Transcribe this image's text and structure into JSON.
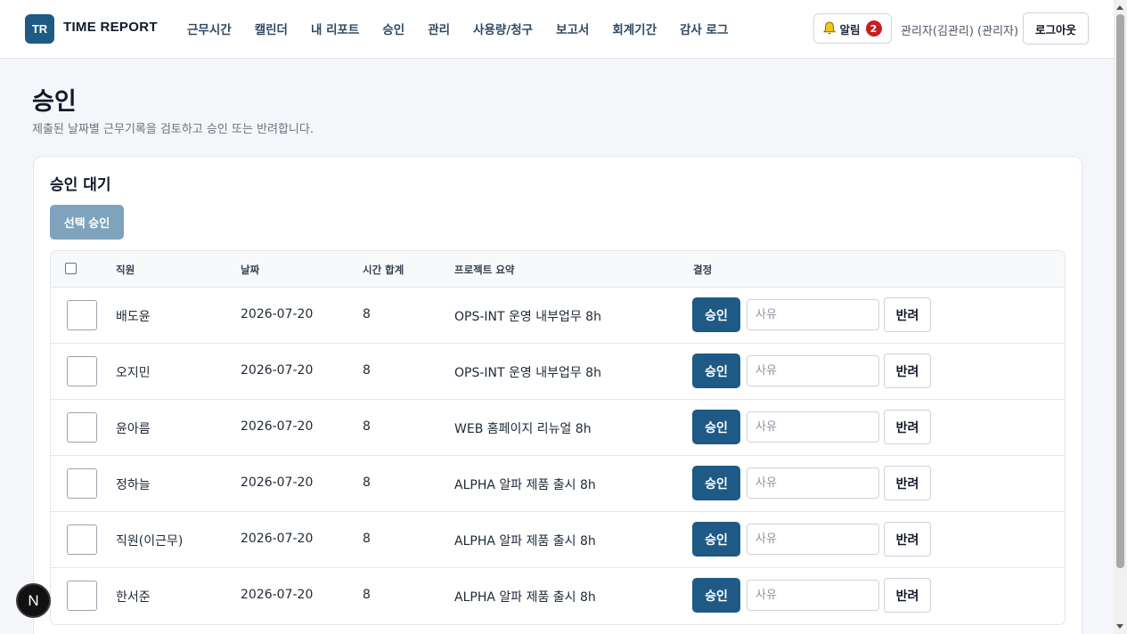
{
  "header": {
    "logo_text": "TR",
    "brand": "TIME REPORT",
    "nav": [
      "근무시간",
      "캘린더",
      "내 리포트",
      "승인",
      "관리",
      "사용량/청구",
      "보고서",
      "회계기간",
      "감사 로그"
    ],
    "alarm_label": "알림",
    "alarm_count": "2",
    "user_label": "관리자(김관리) (관리자)",
    "logout_label": "로그아웃"
  },
  "page": {
    "title": "승인",
    "subtitle": "제출된 날짜별 근무기록을 검토하고 승인 또는 반려합니다."
  },
  "card": {
    "title": "승인 대기",
    "bulk_approve_label": "선택 승인"
  },
  "table": {
    "headers": {
      "employee": "직원",
      "date": "날짜",
      "hours": "시간 합계",
      "project": "프로젝트 요약",
      "decision": "결정"
    },
    "rows": [
      {
        "employee": "배도윤",
        "date": "2026-07-20",
        "hours": "8",
        "project": "OPS-INT 운영 내부업무 8h",
        "approve": "승인",
        "reason_placeholder": "사유",
        "reject": "반려"
      },
      {
        "employee": "오지민",
        "date": "2026-07-20",
        "hours": "8",
        "project": "OPS-INT 운영 내부업무 8h",
        "approve": "승인",
        "reason_placeholder": "사유",
        "reject": "반려"
      },
      {
        "employee": "윤아름",
        "date": "2026-07-20",
        "hours": "8",
        "project": "WEB 홈페이지 리뉴얼 8h",
        "approve": "승인",
        "reason_placeholder": "사유",
        "reject": "반려"
      },
      {
        "employee": "정하늘",
        "date": "2026-07-20",
        "hours": "8",
        "project": "ALPHA 알파 제품 출시 8h",
        "approve": "승인",
        "reason_placeholder": "사유",
        "reject": "반려"
      },
      {
        "employee": "직원(이근무)",
        "date": "2026-07-20",
        "hours": "8",
        "project": "ALPHA 알파 제품 출시 8h",
        "approve": "승인",
        "reason_placeholder": "사유",
        "reject": "반려"
      },
      {
        "employee": "한서준",
        "date": "2026-07-20",
        "hours": "8",
        "project": "ALPHA 알파 제품 출시 8h",
        "approve": "승인",
        "reason_placeholder": "사유",
        "reject": "반려"
      }
    ]
  },
  "dev_badge": "N",
  "colors": {
    "accent": "#1e5a85",
    "accent_disabled": "#7fa2bd",
    "badge_red": "#c81e1e"
  },
  "icons": {
    "alarm": "bell-icon"
  }
}
